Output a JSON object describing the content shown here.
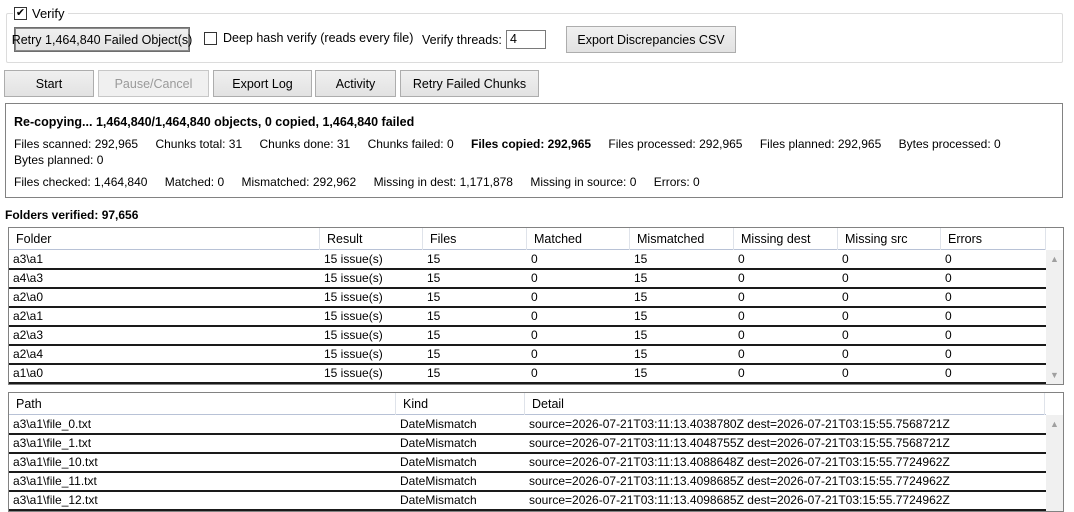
{
  "verify_group": {
    "enabled_label": "Verify",
    "enabled_checked": true,
    "retry_button": "Retry 1,464,840 Failed Object(s)",
    "deep_hash_label": "Deep hash verify (reads every file)",
    "deep_hash_checked": false,
    "threads_label": "Verify threads:",
    "threads_value": "4",
    "export_discrepancies_button": "Export Discrepancies CSV"
  },
  "toolbar": {
    "start": "Start",
    "pause_cancel": "Pause/Cancel",
    "export_log": "Export Log",
    "activity": "Activity",
    "retry_failed_chunks": "Retry Failed Chunks"
  },
  "status": {
    "headline": "Re-copying... 1,464,840/1,464,840 objects, 0 copied, 1,464,840 failed",
    "files_scanned": "Files scanned: 292,965",
    "chunks_total": "Chunks total: 31",
    "chunks_done": "Chunks done: 31",
    "chunks_failed": "Chunks failed: 0",
    "files_copied": "Files copied: 292,965",
    "files_processed": "Files processed: 292,965",
    "files_planned": "Files planned: 292,965",
    "bytes_processed": "Bytes processed: 0",
    "bytes_planned": "Bytes planned: 0",
    "files_checked": "Files checked: 1,464,840",
    "matched": "Matched: 0",
    "mismatched": "Mismatched: 292,962",
    "missing_in_dest": "Missing in dest: 1,171,878",
    "missing_in_source": "Missing in source: 0",
    "errors": "Errors: 0"
  },
  "folders_verified": "Folders verified: 97,656",
  "folders_grid": {
    "columns": [
      "Folder",
      "Result",
      "Files",
      "Matched",
      "Mismatched",
      "Missing dest",
      "Missing src",
      "Errors"
    ],
    "rows": [
      [
        "a3\\a1",
        "15 issue(s)",
        "15",
        "0",
        "15",
        "0",
        "0",
        "0"
      ],
      [
        "a4\\a3",
        "15 issue(s)",
        "15",
        "0",
        "15",
        "0",
        "0",
        "0"
      ],
      [
        "a2\\a0",
        "15 issue(s)",
        "15",
        "0",
        "15",
        "0",
        "0",
        "0"
      ],
      [
        "a2\\a1",
        "15 issue(s)",
        "15",
        "0",
        "15",
        "0",
        "0",
        "0"
      ],
      [
        "a2\\a3",
        "15 issue(s)",
        "15",
        "0",
        "15",
        "0",
        "0",
        "0"
      ],
      [
        "a2\\a4",
        "15 issue(s)",
        "15",
        "0",
        "15",
        "0",
        "0",
        "0"
      ],
      [
        "a1\\a0",
        "15 issue(s)",
        "15",
        "0",
        "15",
        "0",
        "0",
        "0"
      ]
    ]
  },
  "files_grid": {
    "columns": [
      "Path",
      "Kind",
      "Detail"
    ],
    "rows": [
      [
        "a3\\a1\\file_0.txt",
        "DateMismatch",
        "source=2026-07-21T03:11:13.4038780Z dest=2026-07-21T03:15:55.7568721Z"
      ],
      [
        "a3\\a1\\file_1.txt",
        "DateMismatch",
        "source=2026-07-21T03:11:13.4048755Z dest=2026-07-21T03:15:55.7568721Z"
      ],
      [
        "a3\\a1\\file_10.txt",
        "DateMismatch",
        "source=2026-07-21T03:11:13.4088648Z dest=2026-07-21T03:15:55.7724962Z"
      ],
      [
        "a3\\a1\\file_11.txt",
        "DateMismatch",
        "source=2026-07-21T03:11:13.4098685Z dest=2026-07-21T03:15:55.7724962Z"
      ],
      [
        "a3\\a1\\file_12.txt",
        "DateMismatch",
        "source=2026-07-21T03:11:13.4098685Z dest=2026-07-21T03:15:55.7724962Z"
      ]
    ]
  },
  "icons": {
    "scroll_up": "chevron-up-icon",
    "scroll_down": "chevron-down-icon"
  }
}
